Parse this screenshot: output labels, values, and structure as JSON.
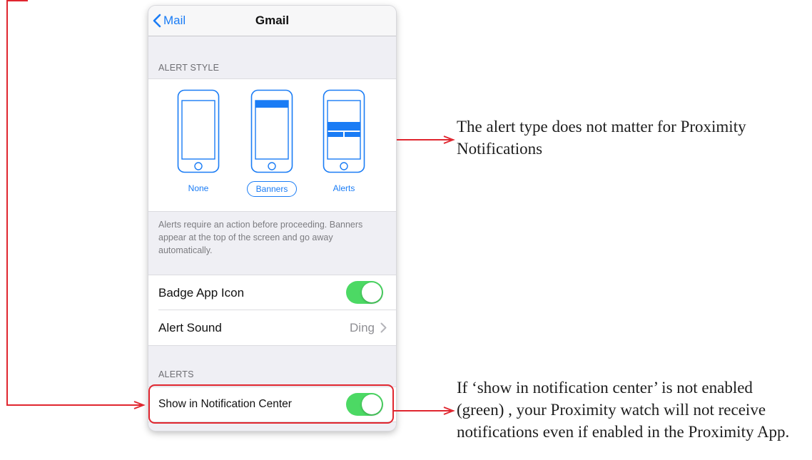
{
  "navbar": {
    "back_label": "Mail",
    "title": "Gmail"
  },
  "alert_style": {
    "header": "ALERT STYLE",
    "options": [
      {
        "label": "None",
        "selected": false
      },
      {
        "label": "Banners",
        "selected": true
      },
      {
        "label": "Alerts",
        "selected": false
      }
    ],
    "description": "Alerts require an action before proceeding. Banners appear at the top of the screen and go away automatically."
  },
  "settings": {
    "badge_app_icon": {
      "label": "Badge App Icon",
      "on": true
    },
    "alert_sound": {
      "label": "Alert Sound",
      "value": "Ding"
    }
  },
  "alerts": {
    "header": "ALERTS",
    "show_in_notification_center": {
      "label": "Show in Notification Center",
      "on": true
    }
  },
  "callouts": {
    "top": "The alert type does not matter for Proximity Notifications",
    "bottom": "If ‘show in notification center’ is not enabled (green) , your Proximity watch will not receive notifications even if enabled in the Proximity App."
  },
  "colors": {
    "accent": "#1a7cf5",
    "toggle_on": "#4cd964",
    "annotation": "#e0262f"
  }
}
